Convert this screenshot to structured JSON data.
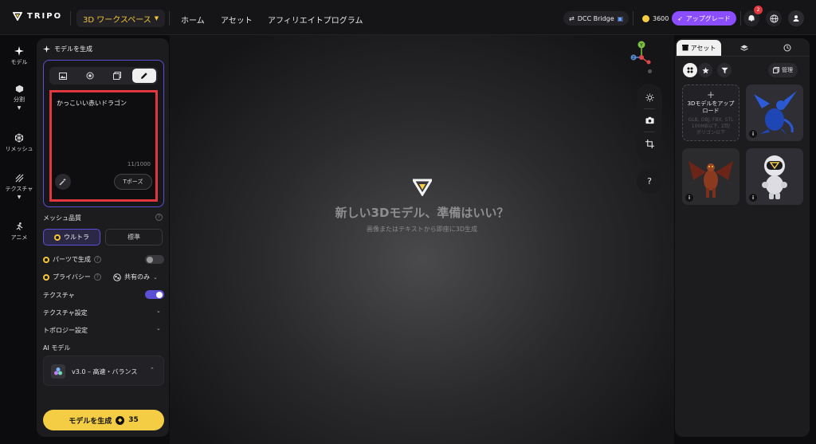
{
  "topbar": {
    "brand": "TRIPO",
    "workspace": "3D ワークスペース",
    "nav": [
      "ホーム",
      "アセット",
      "アフィリエイトプログラム"
    ],
    "dcc_bridge": "DCC Bridge",
    "credits": "3600",
    "upgrade": "アップグレード",
    "notification_count": "2"
  },
  "rail": {
    "items": [
      {
        "label": "モデル",
        "icon": "sparkle-icon"
      },
      {
        "label": "分割",
        "icon": "cube-icon"
      },
      {
        "label": "リメッシュ",
        "icon": "mesh-icon"
      },
      {
        "label": "テクスチャ",
        "icon": "texture-icon"
      },
      {
        "label": "アニメ",
        "icon": "run-icon"
      }
    ]
  },
  "left": {
    "title": "モデルを生成",
    "prompt": "かっこいい赤いドラゴン",
    "counter": "11/1000",
    "tpose": "Tポーズ",
    "mesh_quality_label": "メッシュ品質",
    "quality_ultra": "ウルトラ",
    "quality_standard": "標準",
    "parts_label": "パーツで生成",
    "privacy_label": "プライバシー",
    "privacy_value": "共有のみ",
    "texture_label": "テクスチャ",
    "texture_settings": "テクスチャ設定",
    "topology_settings": "トポロジー設定",
    "ai_model_label": "AI モデル",
    "ai_model_value": "v3.0 – 高速・バランス",
    "generate_label": "モデルを生成",
    "generate_cost": "35"
  },
  "viewport": {
    "title": "新しい3Dモデル、準備はいい？",
    "subtitle": "画像またはテキストから即座に3D生成",
    "help": "?",
    "axis_y": "Y",
    "axis_z": "Z"
  },
  "right": {
    "tab_assets": "アセット",
    "manage": "管理",
    "upload_title": "3Dモデルをアップロード",
    "upload_formats": "GLB, OBJ, FBX, STL",
    "upload_limit": "100MB以下, 1回/",
    "upload_extra": "ポリゴン以下",
    "info": "i"
  },
  "colors": {
    "accent_yellow": "#f4cd44",
    "accent_purple": "#5b4fd6",
    "highlight_red": "#e0383e",
    "upgrade_purple": "#8a4dff"
  }
}
